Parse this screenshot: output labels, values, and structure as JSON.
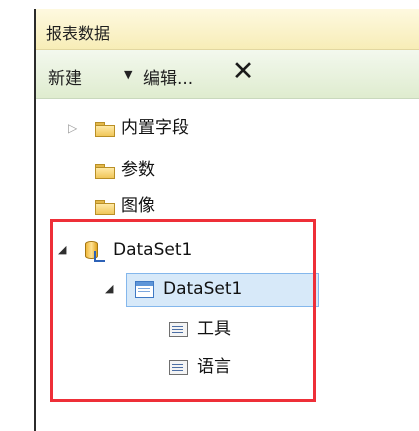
{
  "panel": {
    "title": "报表数据"
  },
  "toolbar": {
    "new_label": "新建",
    "new_dropdown_glyph": "▼",
    "edit_label": "编辑...",
    "delete_glyph": "✕"
  },
  "tree": {
    "builtin_fields": {
      "label": "内置字段",
      "toggle": "▷",
      "icon": "folder-icon"
    },
    "parameters": {
      "label": "参数",
      "icon": "folder-icon"
    },
    "images": {
      "label": "图像",
      "icon": "folder-icon"
    },
    "data_source": {
      "label": "DataSet1",
      "toggle": "◢",
      "icon": "data-source-icon"
    },
    "dataset": {
      "label": "DataSet1",
      "toggle": "◢",
      "icon": "dataset-table-icon",
      "selected": true
    },
    "fields": [
      {
        "label": "工具",
        "icon": "field-icon"
      },
      {
        "label": "语言",
        "icon": "field-icon"
      }
    ]
  },
  "colors": {
    "title_bar": "#f7edb7",
    "toolbar": "#dfeccf",
    "selection": "#d7e9f9",
    "highlight_border": "#ee2f38"
  }
}
